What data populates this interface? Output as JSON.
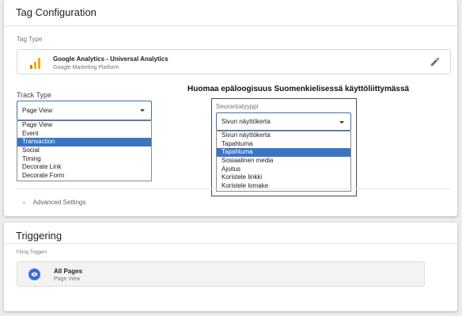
{
  "tag_card": {
    "title": "Tag Configuration",
    "tag_type_label": "Tag Type",
    "tag_type_name": "Google Analytics - Universal Analytics",
    "tag_type_vendor": "Google Marketing Platform",
    "track_type_label": "Track Type",
    "track_type_value": "Page View",
    "track_type_options": [
      "Page View",
      "Event",
      "Transaction",
      "Social",
      "Timing",
      "Decorate Link",
      "Decorate Form"
    ],
    "highlighted_option": "Transaction",
    "advanced_settings": "Advanced Settings"
  },
  "annotation": {
    "note": "Huomaa epäloogisuus Suomenkielisessä käyttöliittymässä",
    "fi_label": "Seurantatyyppi",
    "fi_value": "Sivun näyttökerta",
    "fi_options": [
      "Sivun näyttökerta",
      "Tapahtuma",
      "Tapahtuma",
      "Sosiaalinen media",
      "Ajoitus",
      "Koristele linkki",
      "Koristele lomake"
    ],
    "fi_highlighted_index": 2
  },
  "trigger_card": {
    "title": "Triggering",
    "firing_label": "Firing Triggers",
    "trigger_name": "All Pages",
    "trigger_type": "Page View"
  },
  "icons": {
    "ga": "google-analytics-icon",
    "edit": "pencil-icon",
    "expand": "chevron-right-icon",
    "trigger": "eye-icon",
    "dropdown": "caret-down-icon"
  },
  "colors": {
    "accent_blue": "#3a75c4",
    "ga_orange": "#f9ab00",
    "ga_dark_orange": "#e37400",
    "trigger_blue": "#3d6ed8"
  }
}
